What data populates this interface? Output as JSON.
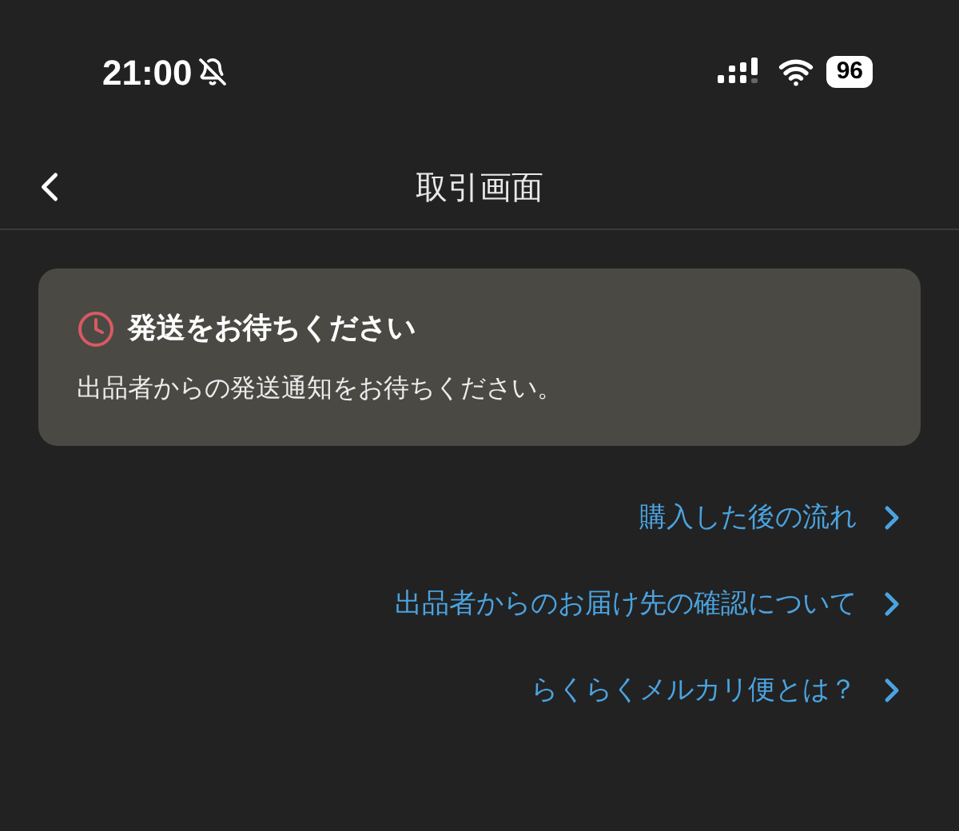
{
  "status_bar": {
    "time": "21:00",
    "silent": true,
    "battery": "96"
  },
  "nav": {
    "title": "取引画面"
  },
  "notice": {
    "title": "発送をお待ちください",
    "message": "出品者からの発送通知をお待ちください。"
  },
  "links": [
    {
      "label": "購入した後の流れ"
    },
    {
      "label": "出品者からのお届け先の確認について"
    },
    {
      "label": "らくらくメルカリ便とは？"
    }
  ]
}
